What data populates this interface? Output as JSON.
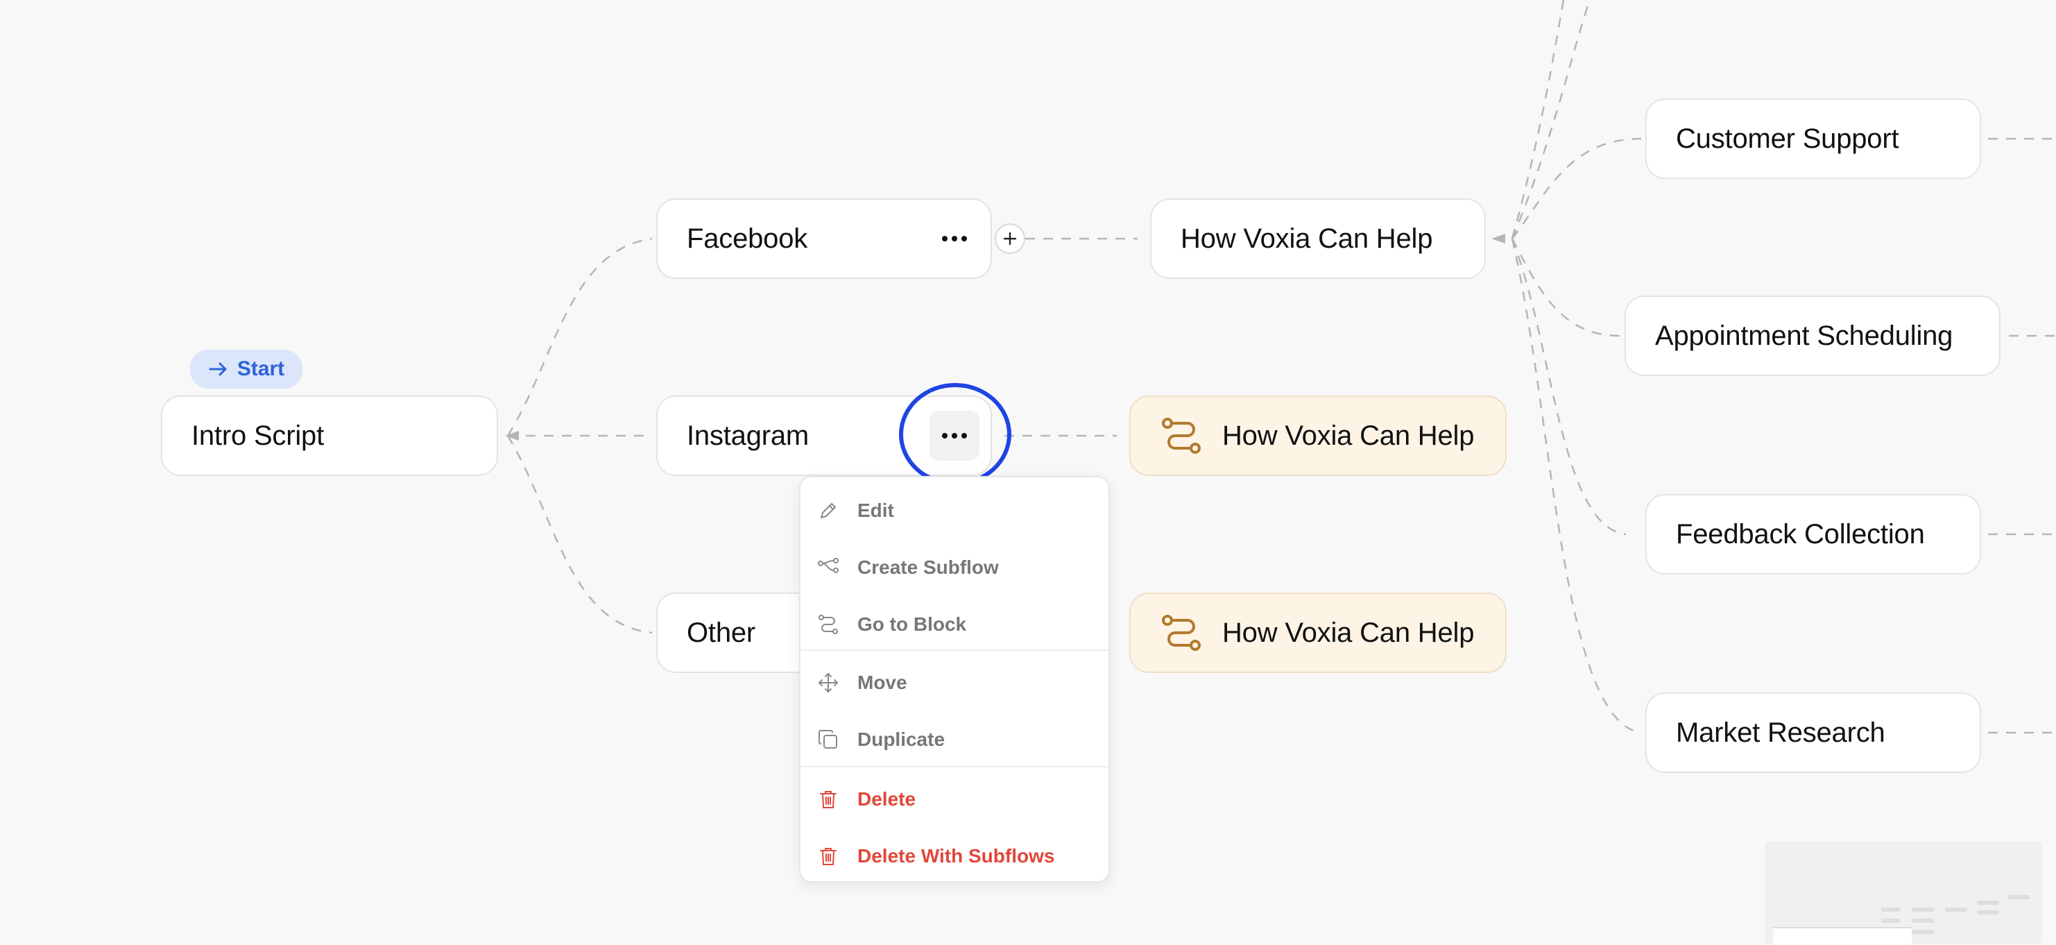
{
  "start_badge": {
    "label": "Start",
    "icon": "arrow-right-icon"
  },
  "nodes": {
    "intro_script": "Intro Script",
    "facebook": "Facebook",
    "instagram": "Instagram",
    "other": "Other",
    "how_voxia_can_help": "How Voxia Can Help",
    "subflow_1": "How Voxia Can Help",
    "subflow_2": "How Voxia Can Help",
    "customer_support": "Customer Support",
    "appointment_scheduling": "Appointment Scheduling",
    "feedback_collection": "Feedback Collection",
    "market_research": "Market Research"
  },
  "context_menu": {
    "items": [
      {
        "label": "Edit",
        "icon": "pencil-icon"
      },
      {
        "label": "Create Subflow",
        "icon": "subflow-icon"
      },
      {
        "label": "Go to Block",
        "icon": "route-icon"
      },
      {
        "label": "Move",
        "icon": "move-arrows-icon"
      },
      {
        "label": "Duplicate",
        "icon": "duplicate-icon"
      },
      {
        "label": "Delete",
        "icon": "trash-icon"
      },
      {
        "label": "Delete With Subflows",
        "icon": "trash-icon"
      }
    ]
  },
  "colors": {
    "accent_blue": "#2f62d8",
    "highlight_ring": "#1f44e4",
    "danger": "#e0473a",
    "subflow_bg": "#fdf4e6",
    "subflow_icon": "#b27a2d",
    "edge": "#b5b5b5"
  }
}
